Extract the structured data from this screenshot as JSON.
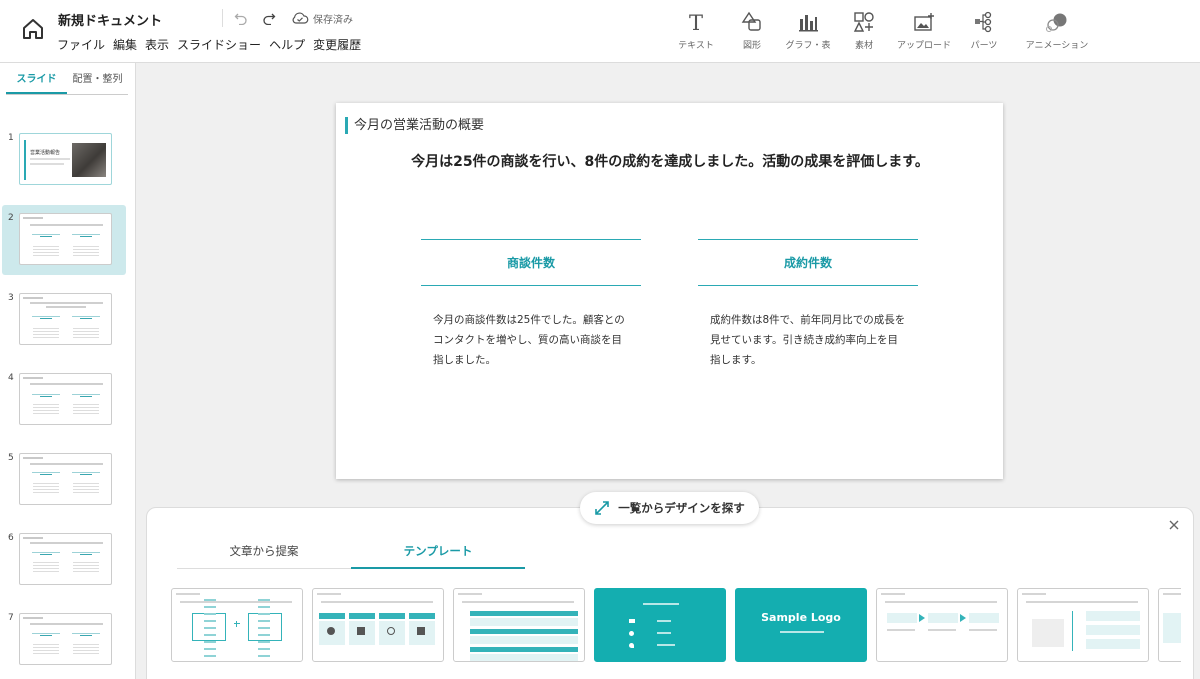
{
  "header": {
    "doc_title": "新規ドキュメント",
    "menu": [
      "ファイル",
      "編集",
      "表示",
      "スライドショー",
      "ヘルプ",
      "変更履歴"
    ],
    "saved_status": "保存済み",
    "tools": [
      {
        "label": "テキスト",
        "icon": "text-icon"
      },
      {
        "label": "図形",
        "icon": "shape-icon"
      },
      {
        "label": "グラフ・表",
        "icon": "bar-chart-icon"
      },
      {
        "label": "素材",
        "icon": "assets-icon"
      },
      {
        "label": "アップロード",
        "icon": "upload-image-icon"
      },
      {
        "label": "パーツ",
        "icon": "parts-icon"
      },
      {
        "label": "アニメーション",
        "icon": "animation-icon"
      }
    ]
  },
  "left_panel": {
    "tabs": [
      "スライド",
      "配置・整列"
    ],
    "slide_numbers": [
      "1",
      "2",
      "3",
      "4",
      "5",
      "6",
      "7"
    ],
    "thumb1_title": "営業活動報告"
  },
  "slide": {
    "title": "今月の営業活動の概要",
    "lead": "今月は25件の商談を行い、8件の成約を達成しました。活動の成果を評価します。",
    "columns": [
      {
        "heading": "商談件数",
        "body": "今月の商談件数は25件でした。顧客とのコンタクトを増やし、質の高い商談を目指しました。"
      },
      {
        "heading": "成約件数",
        "body": "成約件数は8件で、前年同月比での成長を見せています。引き続き成約率向上を目指します。"
      }
    ]
  },
  "explore_button": "一覧からデザインを探す",
  "bottom_panel": {
    "tabs": [
      "文章から提案",
      "テンプレート"
    ],
    "logo_template_text": "Sample Logo"
  },
  "colors": {
    "accent": "#1a9aa6",
    "teal_template": "#14aeb0"
  }
}
